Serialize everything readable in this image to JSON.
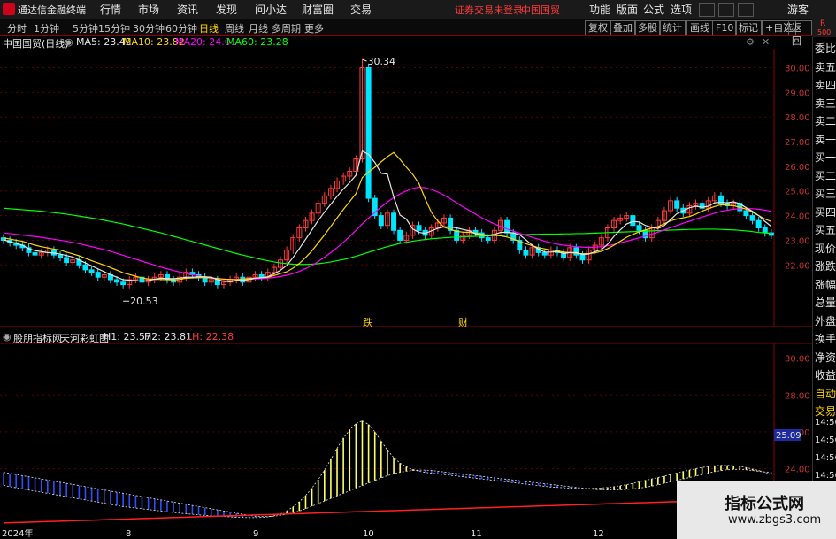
{
  "app": {
    "title": "通达信金融终端"
  },
  "menu": [
    "行情",
    "市场",
    "资讯",
    "发现",
    "问小达",
    "财富圈",
    "交易"
  ],
  "status": {
    "trade": "证券交易未登录",
    "stock": "中国国贸"
  },
  "menu_right": [
    "功能",
    "版面",
    "公式",
    "选项"
  ],
  "visitor": "游客",
  "badge": {
    "r": "R",
    "n": "500"
  },
  "periods": [
    "分时",
    "1分钟",
    "5分钟",
    "15分钟",
    "30分钟",
    "60分钟",
    "日线",
    "周线",
    "月线",
    "多周期",
    "更多"
  ],
  "active_period": "日线",
  "tools": [
    "复权",
    "叠加",
    "多股",
    "统计",
    "画线",
    "F10",
    "标记",
    "+自选",
    "返回"
  ],
  "info": {
    "name": "中国国贸(日线)",
    "ma5": "MA5: 23.42",
    "ma10": "MA10: 23.82",
    "ma20": "MA20: 24.01",
    "ma60": "MA60: 23.28"
  },
  "sub_info": {
    "name": "股朋指标网",
    "title": "天河彩虹图",
    "h1": "H1: 23.57",
    "h2": "H2: 23.81",
    "lh": "LH: 22.38"
  },
  "right_panel": [
    "委比",
    "卖五",
    "卖四",
    "卖三",
    "卖二",
    "卖一",
    "买一",
    "买二",
    "买三",
    "买四",
    "买五",
    "现价",
    "涨跌",
    "涨幅",
    "总量",
    "外盘",
    "换手",
    "净资",
    "收益",
    "自动",
    "交易"
  ],
  "right_times": [
    "14:56",
    "14:56",
    "14:56",
    "14:56",
    "14:56",
    "14:56",
    "14:56"
  ],
  "markers": {
    "high": "30.34",
    "low": "20.53",
    "event1": "跌",
    "event2": "财"
  },
  "sub_marker": "25.09",
  "price_axis": [
    "30.00",
    "29.00",
    "28.00",
    "27.00",
    "26.00",
    "25.00",
    "24.00",
    "23.00",
    "22.00"
  ],
  "sub_axis": [
    "30.00",
    "28.00",
    "26.00",
    "24.00"
  ],
  "time_axis": [
    "2024年",
    "8",
    "9",
    "10",
    "11",
    "12"
  ],
  "watermark": {
    "line1": "指标公式网",
    "line2": "www.zbgs3.com"
  },
  "colors": {
    "up": "#ff3b3b",
    "down": "#00e5ff",
    "ma5": "#e6e6e6",
    "ma10": "#ffd700",
    "ma20": "#ff00ff",
    "ma60": "#00ff00",
    "sub_upper": "#ffff66",
    "sub_lower": "#3050ff",
    "sub_base": "#ff2020"
  },
  "chart_data": {
    "type": "candlestick",
    "ylim": [
      20.0,
      30.7
    ],
    "close": [
      23.0,
      22.9,
      22.8,
      22.7,
      22.5,
      22.4,
      22.5,
      22.6,
      22.4,
      22.3,
      22.1,
      22.2,
      22.0,
      21.8,
      21.7,
      21.5,
      21.6,
      21.4,
      21.3,
      21.2,
      21.4,
      21.5,
      21.3,
      21.4,
      21.5,
      21.6,
      21.4,
      21.3,
      21.5,
      21.7,
      21.6,
      21.5,
      21.3,
      21.4,
      21.2,
      21.3,
      21.4,
      21.5,
      21.3,
      21.5,
      21.6,
      21.5,
      21.7,
      21.9,
      22.2,
      22.6,
      23.1,
      23.5,
      23.8,
      24.1,
      24.5,
      24.8,
      25.1,
      25.4,
      25.6,
      25.8,
      26.3,
      30.0,
      24.7,
      24.0,
      23.6,
      24.1,
      23.4,
      23.0,
      23.2,
      23.6,
      23.4,
      23.2,
      23.5,
      23.7,
      23.9,
      23.4,
      23.0,
      23.2,
      23.4,
      23.3,
      23.1,
      23.0,
      23.4,
      23.8,
      23.3,
      23.0,
      22.6,
      22.4,
      22.7,
      22.5,
      22.4,
      22.6,
      22.5,
      22.3,
      22.7,
      22.4,
      22.2,
      22.6,
      22.8,
      23.1,
      23.5,
      23.8,
      23.9,
      24.0,
      23.6,
      23.4,
      23.1,
      23.5,
      23.8,
      24.2,
      24.6,
      24.3,
      24.1,
      24.4,
      24.5,
      24.3,
      24.6,
      24.8,
      24.5,
      24.4,
      24.5,
      24.2,
      24.0,
      23.8,
      23.5,
      23.3,
      23.2
    ],
    "ma5": [
      23.02,
      22.94,
      22.88,
      22.8,
      22.66,
      22.58,
      22.54,
      22.5,
      22.48,
      22.44,
      22.38,
      22.32,
      22.2,
      22.08,
      21.96,
      21.84,
      21.72,
      21.6,
      21.5,
      21.4,
      21.38,
      21.36,
      21.34,
      21.36,
      21.42,
      21.46,
      21.44,
      21.44,
      21.46,
      21.5,
      21.5,
      21.52,
      21.52,
      21.5,
      21.4,
      21.34,
      21.32,
      21.36,
      21.38,
      21.4,
      21.46,
      21.48,
      21.52,
      21.64,
      21.78,
      21.98,
      22.3,
      22.66,
      23.04,
      23.42,
      23.8,
      24.14,
      24.46,
      24.78,
      25.08,
      25.34,
      25.64,
      26.62,
      26.48,
      26.16,
      25.72,
      25.68,
      24.76,
      24.02,
      23.86,
      23.46,
      23.32,
      23.28,
      23.38,
      23.48,
      23.54,
      23.54,
      23.5,
      23.44,
      23.38,
      23.26,
      23.2,
      23.2,
      23.24,
      23.32,
      23.32,
      23.3,
      23.22,
      23.02,
      22.8,
      22.64,
      22.52,
      22.52,
      22.54,
      22.46,
      22.5,
      22.5,
      22.42,
      22.44,
      22.54,
      22.62,
      22.84,
      23.16,
      23.42,
      23.66,
      23.76,
      23.74,
      23.6,
      23.52,
      23.48,
      23.6,
      23.84,
      24.08,
      24.2,
      24.32,
      24.38,
      24.34,
      24.38,
      24.52,
      24.54,
      24.52,
      24.56,
      24.48,
      24.32,
      24.18,
      24.0,
      23.76,
      23.56
    ],
    "ma10": [
      23.1,
      23.05,
      23.0,
      22.96,
      22.88,
      22.8,
      22.74,
      22.69,
      22.64,
      22.6,
      22.52,
      22.45,
      22.37,
      22.27,
      22.17,
      22.08,
      21.99,
      21.89,
      21.79,
      21.68,
      21.61,
      21.54,
      21.47,
      21.43,
      21.42,
      21.41,
      21.4,
      21.39,
      21.41,
      21.46,
      21.47,
      21.48,
      21.48,
      21.47,
      21.45,
      21.42,
      21.41,
      21.4,
      21.42,
      21.45,
      21.46,
      21.48,
      21.5,
      21.57,
      21.65,
      21.72,
      21.87,
      22.06,
      22.3,
      22.57,
      22.89,
      23.22,
      23.56,
      23.91,
      24.25,
      24.57,
      24.89,
      25.54,
      25.77,
      25.96,
      26.18,
      26.39,
      26.56,
      26.28,
      25.97,
      25.68,
      25.31,
      24.68,
      24.13,
      23.78,
      23.53,
      23.44,
      23.36,
      23.33,
      23.32,
      23.29,
      23.24,
      23.2,
      23.2,
      23.18,
      23.13,
      23.05,
      22.95,
      22.86,
      22.78,
      22.7,
      22.65,
      22.6,
      22.57,
      22.52,
      22.5,
      22.47,
      22.45,
      22.46,
      22.49,
      22.55,
      22.66,
      22.8,
      22.96,
      23.12,
      23.24,
      23.34,
      23.42,
      23.49,
      23.55,
      23.67,
      23.79,
      23.86,
      23.91,
      23.96,
      24.06,
      24.18,
      24.28,
      24.37,
      24.44,
      24.42,
      24.4,
      24.34,
      24.26,
      24.14,
      24.0,
      23.86,
      23.76
    ],
    "ma20": [
      23.3,
      23.27,
      23.24,
      23.21,
      23.18,
      23.15,
      23.12,
      23.08,
      23.04,
      23.0,
      22.96,
      22.91,
      22.86,
      22.8,
      22.74,
      22.68,
      22.62,
      22.55,
      22.47,
      22.39,
      22.31,
      22.23,
      22.15,
      22.07,
      21.99,
      21.91,
      21.84,
      21.77,
      21.71,
      21.66,
      21.6,
      21.55,
      21.5,
      21.46,
      21.43,
      21.42,
      21.41,
      21.41,
      21.41,
      21.42,
      21.43,
      21.44,
      21.46,
      21.49,
      21.53,
      21.58,
      21.65,
      21.74,
      21.85,
      21.98,
      22.14,
      22.31,
      22.5,
      22.7,
      22.92,
      23.15,
      23.4,
      23.66,
      23.9,
      24.13,
      24.35,
      24.55,
      24.73,
      24.88,
      25.0,
      25.1,
      25.15,
      25.13,
      25.06,
      24.96,
      24.83,
      24.68,
      24.52,
      24.36,
      24.21,
      24.06,
      23.91,
      23.78,
      23.66,
      23.56,
      23.46,
      23.37,
      23.28,
      23.2,
      23.12,
      23.04,
      22.96,
      22.9,
      22.84,
      22.8,
      22.77,
      22.74,
      22.72,
      22.71,
      22.72,
      22.74,
      22.78,
      22.83,
      22.89,
      22.96,
      23.03,
      23.1,
      23.17,
      23.25,
      23.33,
      23.42,
      23.51,
      23.6,
      23.69,
      23.77,
      23.86,
      23.94,
      24.02,
      24.1,
      24.17,
      24.22,
      24.26,
      24.28,
      24.29,
      24.28,
      24.26,
      24.22,
      24.17
    ],
    "ma60": [
      24.3,
      24.28,
      24.26,
      24.24,
      24.22,
      24.2,
      24.18,
      24.15,
      24.12,
      24.09,
      24.06,
      24.02,
      23.98,
      23.94,
      23.9,
      23.86,
      23.81,
      23.76,
      23.71,
      23.66,
      23.6,
      23.54,
      23.48,
      23.42,
      23.36,
      23.3,
      23.23,
      23.16,
      23.09,
      23.02,
      22.95,
      22.88,
      22.81,
      22.74,
      22.67,
      22.6,
      22.53,
      22.46,
      22.4,
      22.34,
      22.28,
      22.22,
      22.17,
      22.12,
      22.08,
      22.05,
      22.03,
      22.02,
      22.02,
      22.03,
      22.05,
      22.08,
      22.12,
      22.17,
      22.22,
      22.28,
      22.35,
      22.43,
      22.51,
      22.59,
      22.67,
      22.74,
      22.81,
      22.87,
      22.92,
      22.96,
      23.0,
      23.03,
      23.06,
      23.08,
      23.1,
      23.12,
      23.13,
      23.14,
      23.15,
      23.16,
      23.17,
      23.18,
      23.19,
      23.2,
      23.21,
      23.22,
      23.23,
      23.23,
      23.24,
      23.24,
      23.25,
      23.25,
      23.25,
      23.26,
      23.26,
      23.27,
      23.27,
      23.28,
      23.29,
      23.3,
      23.31,
      23.32,
      23.33,
      23.34,
      23.35,
      23.36,
      23.37,
      23.38,
      23.39,
      23.4,
      23.41,
      23.42,
      23.43,
      23.44,
      23.44,
      23.45,
      23.45,
      23.45,
      23.44,
      23.43,
      23.42,
      23.4,
      23.38,
      23.35,
      23.32,
      23.3,
      23.28
    ],
    "sub": {
      "h1": [
        23.1,
        23.02,
        22.96,
        22.9,
        22.84,
        22.78,
        22.72,
        22.66,
        22.6,
        22.54,
        22.48,
        22.42,
        22.36,
        22.3,
        22.24,
        22.18,
        22.12,
        22.06,
        22.0,
        21.94,
        21.9,
        21.86,
        21.82,
        21.78,
        21.74,
        21.7,
        21.66,
        21.62,
        21.58,
        21.55,
        21.52,
        21.49,
        21.46,
        21.44,
        21.42,
        21.4,
        21.38,
        21.36,
        21.35,
        21.34,
        21.34,
        21.35,
        21.38,
        21.44,
        21.54,
        21.7,
        21.92,
        22.2,
        22.54,
        22.94,
        23.4,
        23.92,
        24.5,
        25.1,
        25.66,
        26.1,
        26.44,
        26.6,
        26.4,
        26.0,
        25.5,
        25.0,
        24.6,
        24.3,
        24.1,
        23.96,
        23.86,
        23.8,
        23.76,
        23.72,
        23.68,
        23.64,
        23.6,
        23.56,
        23.52,
        23.48,
        23.44,
        23.4,
        23.36,
        23.32,
        23.28,
        23.24,
        23.2,
        23.16,
        23.12,
        23.08,
        23.04,
        23.0,
        22.98,
        22.96,
        22.94,
        22.93,
        22.92,
        22.92,
        22.93,
        22.95,
        22.98,
        23.02,
        23.07,
        23.13,
        23.2,
        23.28,
        23.36,
        23.44,
        23.52,
        23.6,
        23.68,
        23.76,
        23.84,
        23.92,
        24.0,
        24.06,
        24.12,
        24.16,
        24.18,
        24.18,
        24.16,
        24.12,
        24.06,
        23.98,
        23.9,
        23.8,
        23.7
      ],
      "h2": [
        23.8,
        23.74,
        23.68,
        23.62,
        23.56,
        23.5,
        23.44,
        23.38,
        23.32,
        23.26,
        23.2,
        23.14,
        23.08,
        23.02,
        22.96,
        22.9,
        22.84,
        22.78,
        22.72,
        22.66,
        22.6,
        22.54,
        22.48,
        22.42,
        22.36,
        22.3,
        22.24,
        22.18,
        22.12,
        22.06,
        22.0,
        21.94,
        21.88,
        21.82,
        21.76,
        21.7,
        21.64,
        21.58,
        21.52,
        21.46,
        21.42,
        21.4,
        21.4,
        21.42,
        21.46,
        21.52,
        21.6,
        21.7,
        21.82,
        21.96,
        22.1,
        22.24,
        22.38,
        22.52,
        22.66,
        22.8,
        22.94,
        23.08,
        23.22,
        23.36,
        23.5,
        23.62,
        23.72,
        23.8,
        23.86,
        23.9,
        23.92,
        23.92,
        23.9,
        23.86,
        23.82,
        23.78,
        23.74,
        23.7,
        23.66,
        23.62,
        23.58,
        23.54,
        23.5,
        23.46,
        23.42,
        23.38,
        23.34,
        23.3,
        23.26,
        23.22,
        23.18,
        23.14,
        23.1,
        23.06,
        23.02,
        22.98,
        22.94,
        22.9,
        22.87,
        22.85,
        22.84,
        22.84,
        22.85,
        22.87,
        22.9,
        22.94,
        22.99,
        23.05,
        23.12,
        23.2,
        23.28,
        23.36,
        23.44,
        23.52,
        23.6,
        23.68,
        23.76,
        23.84,
        23.9,
        23.94,
        23.96,
        23.96,
        23.94,
        23.9,
        23.86,
        23.82,
        23.81
      ]
    }
  }
}
